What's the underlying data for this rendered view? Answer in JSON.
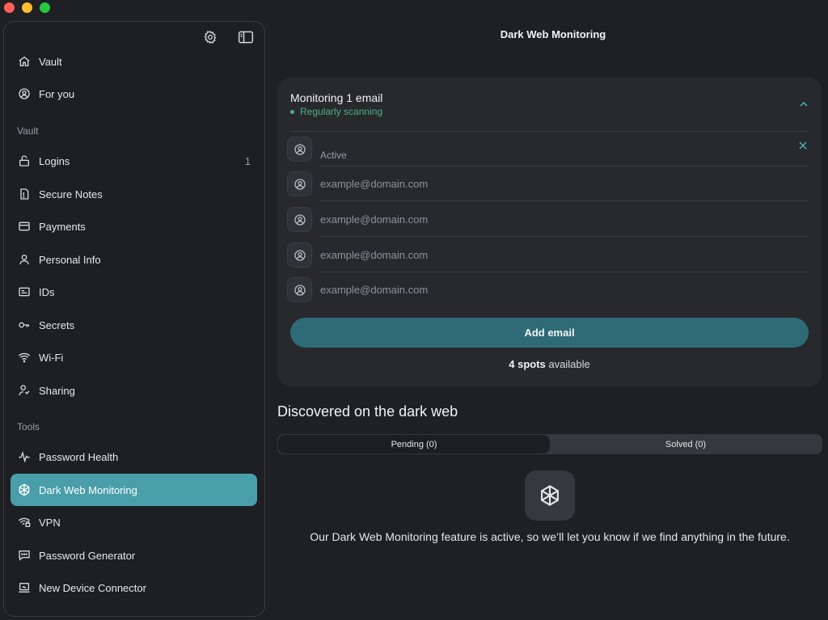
{
  "window": {
    "title": "Dark Web Monitoring",
    "traffic_lights": [
      "close",
      "minimize",
      "zoom"
    ]
  },
  "sidebar": {
    "top_icons": [
      "gear-icon",
      "sidebar-toggle-icon"
    ],
    "items": [
      {
        "label": "Vault",
        "icon": "home-icon"
      },
      {
        "label": "For you",
        "icon": "user-circle-icon"
      }
    ],
    "sections": [
      {
        "label": "Vault",
        "items": [
          {
            "label": "Logins",
            "icon": "lock-icon",
            "count": "1"
          },
          {
            "label": "Secure Notes",
            "icon": "note-icon"
          },
          {
            "label": "Payments",
            "icon": "card-icon"
          },
          {
            "label": "Personal Info",
            "icon": "person-icon"
          },
          {
            "label": "IDs",
            "icon": "id-card-icon"
          },
          {
            "label": "Secrets",
            "icon": "key-icon"
          },
          {
            "label": "Wi-Fi",
            "icon": "wifi-icon"
          },
          {
            "label": "Sharing",
            "icon": "sharing-icon"
          }
        ]
      },
      {
        "label": "Tools",
        "items": [
          {
            "label": "Password Health",
            "icon": "pulse-icon"
          },
          {
            "label": "Dark Web Monitoring",
            "icon": "dark-web-icon",
            "active": true
          },
          {
            "label": "VPN",
            "icon": "vpn-icon"
          },
          {
            "label": "Password Generator",
            "icon": "generator-icon"
          },
          {
            "label": "New Device Connector",
            "icon": "laptop-icon"
          }
        ]
      }
    ]
  },
  "monitoring": {
    "title": "Monitoring 1 email",
    "status": "Regularly scanning",
    "status_color": "#4fb081",
    "rows": [
      {
        "value": "",
        "sub_label": "Active",
        "placeholder": ""
      },
      {
        "value": "",
        "placeholder": "example@domain.com"
      },
      {
        "value": "",
        "placeholder": "example@domain.com"
      },
      {
        "value": "",
        "placeholder": "example@domain.com"
      },
      {
        "value": "",
        "placeholder": "example@domain.com"
      }
    ],
    "add_button": "Add email",
    "spots_count": "4 spots",
    "spots_suffix": " available"
  },
  "discovered": {
    "title": "Discovered on the dark web",
    "tabs": [
      {
        "label": "Pending (0)",
        "selected": true
      },
      {
        "label": "Solved (0)",
        "selected": false
      }
    ],
    "empty_message": "Our Dark Web Monitoring feature is active, so we’ll let you know if we find anything in the future."
  },
  "colors": {
    "accent": "#4a9eaa",
    "button": "#2e6b76",
    "background": "#1e2023",
    "card": "#27292d"
  }
}
